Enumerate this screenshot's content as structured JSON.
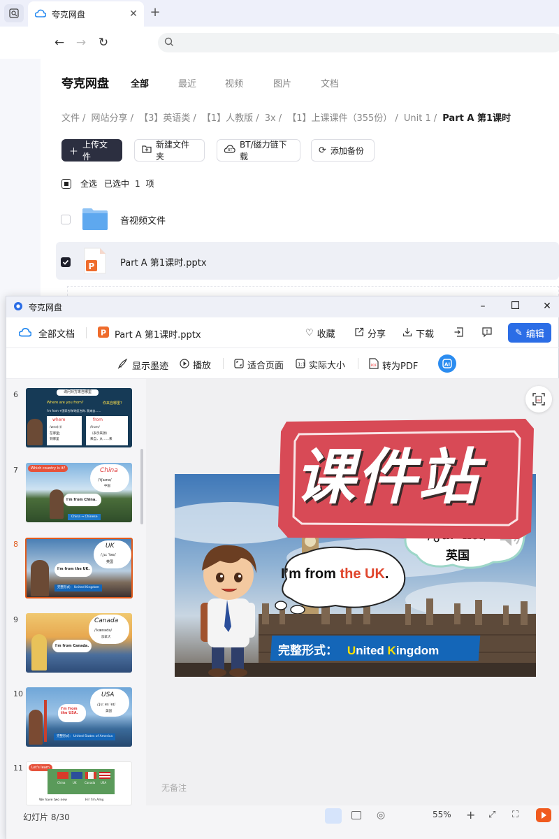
{
  "browser": {
    "tab_title": "夸克网盘",
    "close_glyph": "✕",
    "new_tab_glyph": "+"
  },
  "page": {
    "brand": "夸克网盘",
    "tabs": [
      "全部",
      "最近",
      "视频",
      "图片",
      "文档"
    ],
    "breadcrumb": [
      "文件",
      "网站分享",
      "【3】英语类",
      "【1】人教版",
      "3x",
      "【1】上课课件（355份）",
      "Unit 1",
      "Part A 第1课时"
    ],
    "breadcrumb_sep": "/",
    "actions": {
      "upload": "上传文件",
      "new_folder": "新建文件夹",
      "bt": "BT/磁力链下载",
      "backup": "添加备份"
    },
    "selection": {
      "select_all": "全选",
      "selected_prefix": "已选中",
      "selected_count": "1",
      "selected_suffix": "项"
    },
    "files": [
      {
        "name": "音视频文件",
        "type": "folder",
        "checked": false
      },
      {
        "name": "Part  A 第1课时.pptx",
        "type": "pptx",
        "checked": true
      }
    ]
  },
  "viewer": {
    "window_title": "夸克网盘",
    "all_docs": "全部文档",
    "file_name": "Part A 第1课时.pptx",
    "actions": {
      "favorite": "收藏",
      "share": "分享",
      "download": "下载",
      "edit": "编辑"
    },
    "toolbar": {
      "show_ink": "显示墨迹",
      "play": "播放",
      "fit_page": "适合页面",
      "actual_size": "实际大小",
      "to_pdf": "转为PDF"
    },
    "thumbnails": [
      {
        "num": "6",
        "title": "询问对方来自哪里",
        "lines": [
          "Where are you from?",
          "你来自哪里?",
          "I'm from +国家名称/地区名称. 我来自……",
          "where",
          "/weə(r)/",
          "在哪里；",
          "到哪里",
          "from",
          "/frɒm/",
          "（表示来源）",
          "来自，从……来"
        ]
      },
      {
        "num": "7",
        "title": "Which country is it?",
        "lines": [
          "China",
          "/ˈtʃaɪnə/",
          "中国",
          "I'm from China.",
          "China → Chinese"
        ]
      },
      {
        "num": "8",
        "title": "",
        "lines": [
          "UK",
          "/ˌjuː ˈkeɪ/",
          "英国",
          "I'm from the UK.",
          "完整形式：  United Kingdom"
        ]
      },
      {
        "num": "9",
        "title": "",
        "lines": [
          "Canada",
          "/ˈkænədə/",
          "加拿大",
          "I'm from Canada."
        ]
      },
      {
        "num": "10",
        "title": "",
        "lines": [
          "USA",
          "/ˌjuː es ˈeɪ/",
          "美国",
          "I'm from the USA.",
          "完整形式：  United States of America"
        ]
      },
      {
        "num": "11",
        "title": "Let's learn",
        "lines": [
          "China",
          "UK",
          "Canada",
          "USA",
          "We have two new",
          "Hi! I'm Amy."
        ]
      }
    ],
    "current_slide": {
      "word": "UK",
      "phonetic": "/ˌjuː ˈkeɪ/",
      "meaning": "英国",
      "speech_prefix": "I’m from ",
      "speech_highlight": "the UK",
      "speech_suffix": ".",
      "full_form_label": "完整形式：",
      "full_form_U": "U",
      "full_form_mid": "nited ",
      "full_form_K": "K",
      "full_form_rest": "ingdom"
    },
    "notes_placeholder": "无备注",
    "status": "幻灯片 8/30",
    "zoom": "55%",
    "watermark": "课件站",
    "colors": {
      "accent": "#2b6de6",
      "highlight_red": "#e0452c",
      "highlight_yellow": "#ffe000",
      "banner_blue": "#1466b8",
      "watermark_red": "#d84a56"
    }
  }
}
